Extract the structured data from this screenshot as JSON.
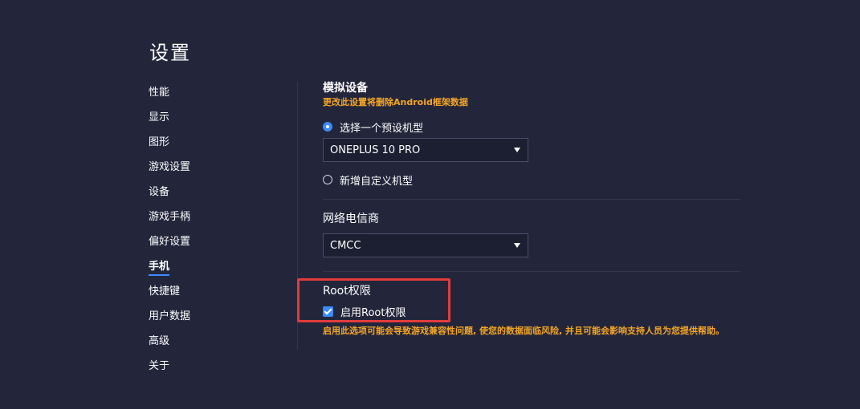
{
  "page": {
    "title": "设置"
  },
  "sidebar": {
    "items": [
      {
        "label": "性能"
      },
      {
        "label": "显示"
      },
      {
        "label": "图形"
      },
      {
        "label": "游戏设置"
      },
      {
        "label": "设备"
      },
      {
        "label": "游戏手柄"
      },
      {
        "label": "偏好设置"
      },
      {
        "label": "手机",
        "active": true
      },
      {
        "label": "快捷键"
      },
      {
        "label": "用户数据"
      },
      {
        "label": "高级"
      },
      {
        "label": "关于"
      }
    ]
  },
  "device": {
    "title": "模拟设备",
    "warning": "更改此设置将删除Android框架数据",
    "preset_option": "选择一个预设机型",
    "preset_selected": true,
    "preset_value": "ONEPLUS 10 PRO",
    "custom_option": "新增自定义机型"
  },
  "carrier": {
    "title": "网络电信商",
    "value": "CMCC"
  },
  "root": {
    "title": "Root权限",
    "checkbox_label": "启用Root权限",
    "checked": true,
    "warning": "启用此选项可能会导致游戏兼容性问题, 使您的数据面临风险, 并且可能会影响支持人员为您提供帮助。"
  },
  "colors": {
    "background": "#23263b",
    "accent": "#3b8cff",
    "warning": "#f5a623",
    "highlight": "#e23b3b"
  }
}
